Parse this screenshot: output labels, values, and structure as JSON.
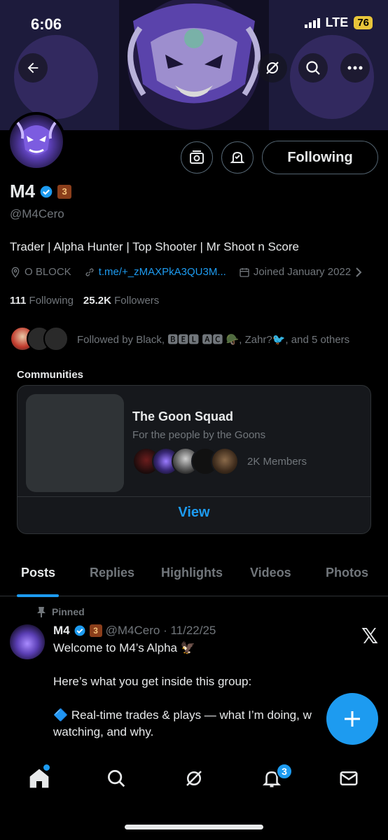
{
  "status_bar": {
    "time": "6:06",
    "network": "LTE",
    "battery": "76"
  },
  "profile": {
    "name": "M4",
    "handle": "@M4Cero",
    "bio": "Trader | Alpha Hunter | Top Shooter | Mr Shoot n Score",
    "location": "O BLOCK",
    "link": "t.me/+_zMAXPkA3QU3M...",
    "joined": "Joined January 2022",
    "following_count": "111",
    "following_label": "Following",
    "followers_count": "25.2K",
    "followers_label": "Followers",
    "follow_button": "Following",
    "followed_by": "Followed by Black, 🅱🅴🅻 🅰🅲 🪖, Zahr?🐦, and 5 others",
    "badge_label": "3"
  },
  "communities": {
    "title": "Communities",
    "name": "The Goon Squad",
    "description": "For the people by the Goons",
    "members": "2K Members",
    "view_button": "View"
  },
  "tabs": [
    "Posts",
    "Replies",
    "Highlights",
    "Videos",
    "Photos"
  ],
  "active_tab": "Posts",
  "post": {
    "pinned_label": "Pinned",
    "author": "M4",
    "handle_date": "@M4Cero · 11/22/25",
    "line1": "Welcome to M4’s Alpha 🦅",
    "line2": "Here’s what you get inside this group:",
    "line3": "🔷 Real-time trades & plays — what I’m doing, w",
    "line4": "watching, and why."
  },
  "nav": {
    "notification_count": "3",
    "items": [
      "home-icon",
      "search-icon",
      "grok-icon",
      "notifications-icon",
      "messages-icon"
    ]
  },
  "colors": {
    "accent": "#1d9bf0",
    "background": "#000000",
    "secondary_text": "#71767b"
  }
}
